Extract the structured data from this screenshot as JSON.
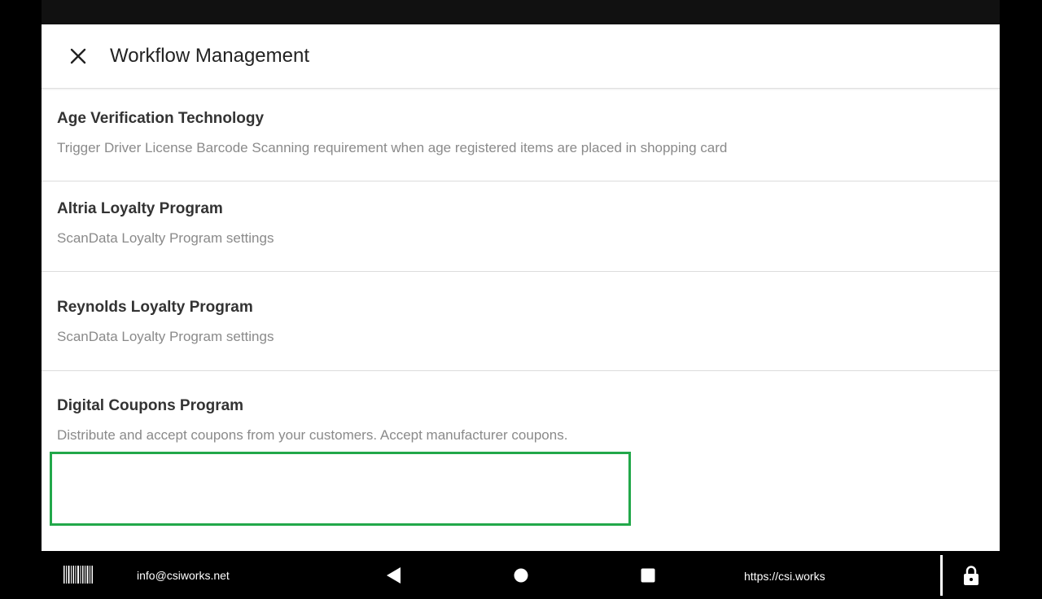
{
  "header": {
    "title": "Workflow Management",
    "close_icon": "close-icon"
  },
  "settings": {
    "items": [
      {
        "title": "Age Verification Technology",
        "description": "Trigger Driver License Barcode Scanning requirement when age registered items are placed in shopping card"
      },
      {
        "title": "Altria Loyalty Program",
        "description": "ScanData Loyalty Program settings"
      },
      {
        "title": "Reynolds Loyalty Program",
        "description": "ScanData Loyalty Program settings"
      },
      {
        "title": "Digital Coupons Program",
        "description": "Distribute and accept coupons from your customers. Accept manufacturer coupons."
      }
    ]
  },
  "nav_bar": {
    "email": "info@csiworks.net",
    "url": "https://csi.works",
    "icons": [
      "barcode-icon",
      "back-triangle-icon",
      "home-circle-icon",
      "recents-square-icon",
      "lock-icon"
    ]
  },
  "colors": {
    "highlight": "#22a84a",
    "title_text": "#333333",
    "desc_text": "#8a8a8a"
  }
}
